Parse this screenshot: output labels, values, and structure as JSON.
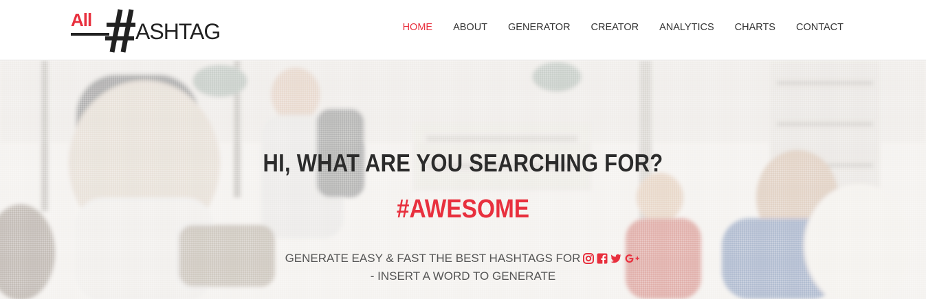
{
  "header": {
    "logo": {
      "part1": "All",
      "part2": "ASHTAG"
    },
    "nav": [
      {
        "label": "HOME",
        "active": true
      },
      {
        "label": "ABOUT",
        "active": false
      },
      {
        "label": "GENERATOR",
        "active": false
      },
      {
        "label": "CREATOR",
        "active": false
      },
      {
        "label": "ANALYTICS",
        "active": false
      },
      {
        "label": "CHARTS",
        "active": false
      },
      {
        "label": "CONTACT",
        "active": false
      }
    ]
  },
  "hero": {
    "title": "HI, WHAT ARE YOU SEARCHING FOR?",
    "hashtag": "#AWESOME",
    "subtitle_line1": "GENERATE EASY & FAST THE BEST HASHTAGS FOR",
    "subtitle_line2": "- INSERT A WORD TO GENERATE",
    "social_icons": [
      "instagram-icon",
      "facebook-icon",
      "twitter-icon",
      "google-plus-icon"
    ]
  },
  "colors": {
    "accent": "#e8303e",
    "text_dark": "#2b2b2b",
    "text_muted": "#555555"
  }
}
